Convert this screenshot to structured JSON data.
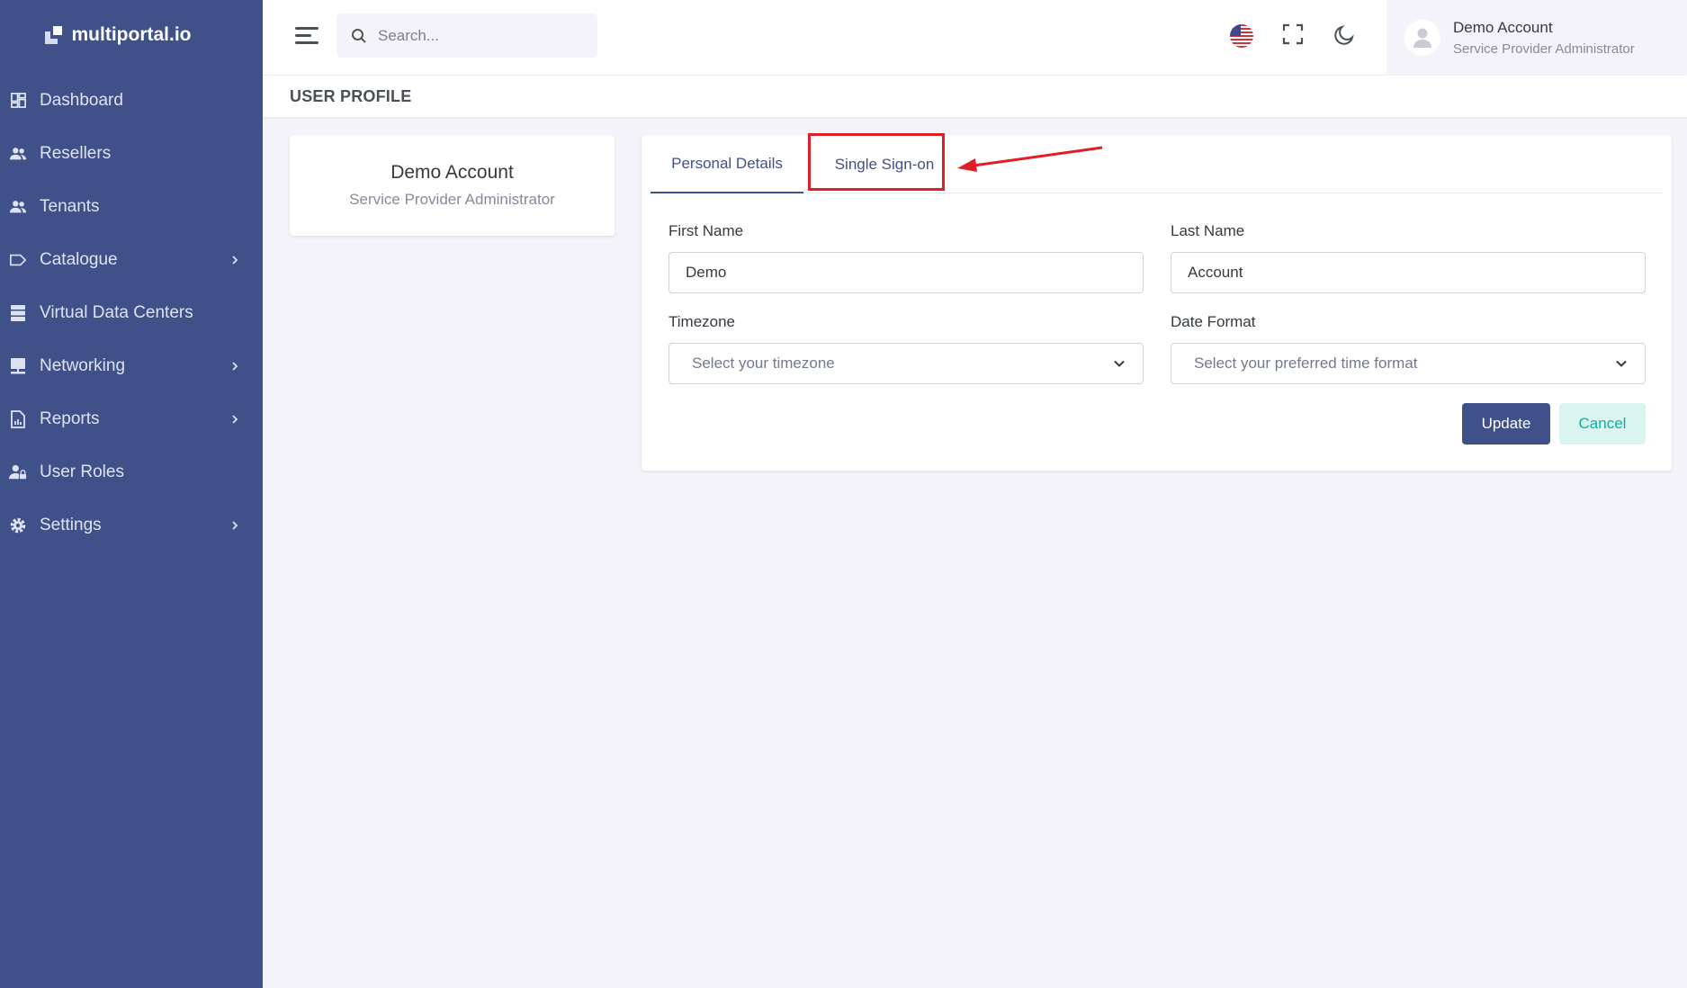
{
  "brand": {
    "name": "multiportal.io"
  },
  "sidebar": {
    "items": [
      {
        "label": "Dashboard",
        "icon": "dashboard-icon",
        "has_submenu": false
      },
      {
        "label": "Resellers",
        "icon": "users-icon",
        "has_submenu": false
      },
      {
        "label": "Tenants",
        "icon": "users-icon",
        "has_submenu": false
      },
      {
        "label": "Catalogue",
        "icon": "tag-icon",
        "has_submenu": true
      },
      {
        "label": "Virtual Data Centers",
        "icon": "server-icon",
        "has_submenu": false
      },
      {
        "label": "Networking",
        "icon": "network-icon",
        "has_submenu": true
      },
      {
        "label": "Reports",
        "icon": "report-icon",
        "has_submenu": true
      },
      {
        "label": "User Roles",
        "icon": "user-lock-icon",
        "has_submenu": false
      },
      {
        "label": "Settings",
        "icon": "gear-icon",
        "has_submenu": true
      }
    ]
  },
  "header": {
    "search_placeholder": "Search...",
    "language_flag": "us-flag-icon",
    "user": {
      "name": "Demo Account",
      "role": "Service Provider Administrator"
    }
  },
  "page": {
    "title": "USER PROFILE"
  },
  "profile_card": {
    "name": "Demo Account",
    "role": "Service Provider Administrator"
  },
  "tabs": [
    {
      "label": "Personal Details",
      "active": true
    },
    {
      "label": "Single Sign-on",
      "active": false,
      "highlighted": true
    }
  ],
  "form": {
    "first_name": {
      "label": "First Name",
      "value": "Demo"
    },
    "last_name": {
      "label": "Last Name",
      "value": "Account"
    },
    "timezone": {
      "label": "Timezone",
      "placeholder": "Select your timezone"
    },
    "date_format": {
      "label": "Date Format",
      "placeholder": "Select your preferred time format"
    },
    "update_label": "Update",
    "cancel_label": "Cancel"
  },
  "colors": {
    "sidebar_bg": "#405189",
    "primary": "#405189",
    "highlight": "#e01e26",
    "cancel_text": "#0ab39c",
    "page_bg": "#f3f3f9"
  }
}
